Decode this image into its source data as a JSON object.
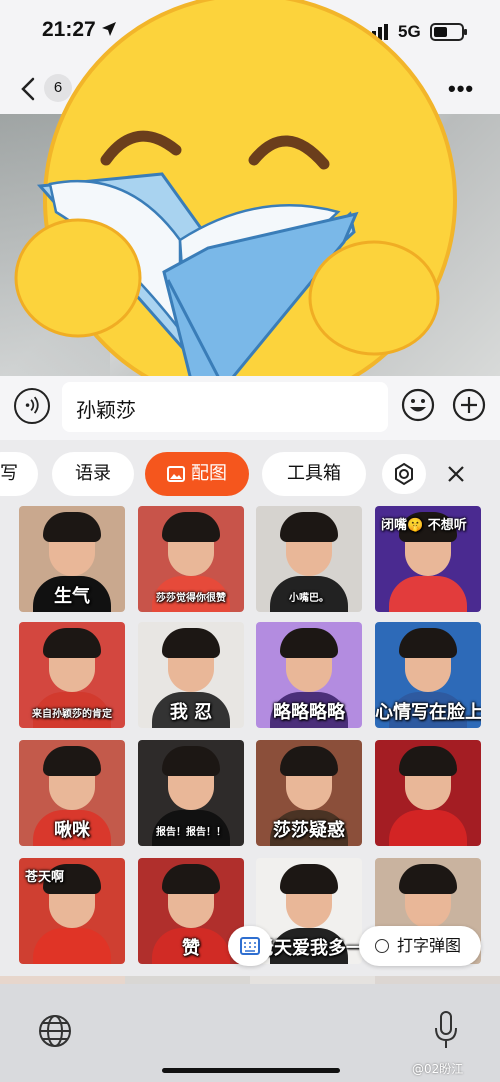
{
  "status": {
    "time": "21:27",
    "network": "5G"
  },
  "nav": {
    "back_count": "6",
    "more_label": "•••"
  },
  "input": {
    "text": "孙颖莎"
  },
  "tabs": [
    {
      "label": "写"
    },
    {
      "label": "语录"
    },
    {
      "label": "配图",
      "active": true
    },
    {
      "label": "工具箱"
    }
  ],
  "stickers": [
    {
      "caption": "生气",
      "size": "big"
    },
    {
      "caption": "莎莎觉得你很赞",
      "size": "small"
    },
    {
      "caption": "小嘴巴。",
      "size": "small"
    },
    {
      "caption": "闭嘴🤫 不想听",
      "size": "topleft"
    },
    {
      "caption": "来自孙颖莎的肯定",
      "size": "small"
    },
    {
      "caption": "我 忍",
      "size": "big"
    },
    {
      "caption": "略略略略",
      "size": "big"
    },
    {
      "caption": "心情写在脸上",
      "size": "big"
    },
    {
      "caption": "啾咪",
      "size": "big"
    },
    {
      "caption": "报告！报告！！",
      "size": "small"
    },
    {
      "caption": "莎莎疑惑",
      "size": "big"
    },
    {
      "caption": "",
      "size": "big"
    },
    {
      "caption": "苍天啊",
      "size": "topleft"
    },
    {
      "caption": "赞",
      "size": "big"
    },
    {
      "caption": "老天爱我多一点",
      "size": "big"
    },
    {
      "caption": "",
      "size": "big"
    }
  ],
  "floating": {
    "typing_label": "打字弹图"
  },
  "watermark": "@02盼江",
  "colors": {
    "accent": "#f5561d",
    "emoji_yellow": "#fcd33c",
    "book_blue": "#7ab8e8"
  },
  "icons": [
    "location-arrow-icon",
    "signal-icon",
    "battery-icon",
    "back-chevron-icon",
    "voice-icon",
    "smile-icon",
    "plus-icon",
    "picture-icon",
    "gear-icon",
    "close-icon",
    "keyboard-icon",
    "globe-icon",
    "mic-icon"
  ]
}
